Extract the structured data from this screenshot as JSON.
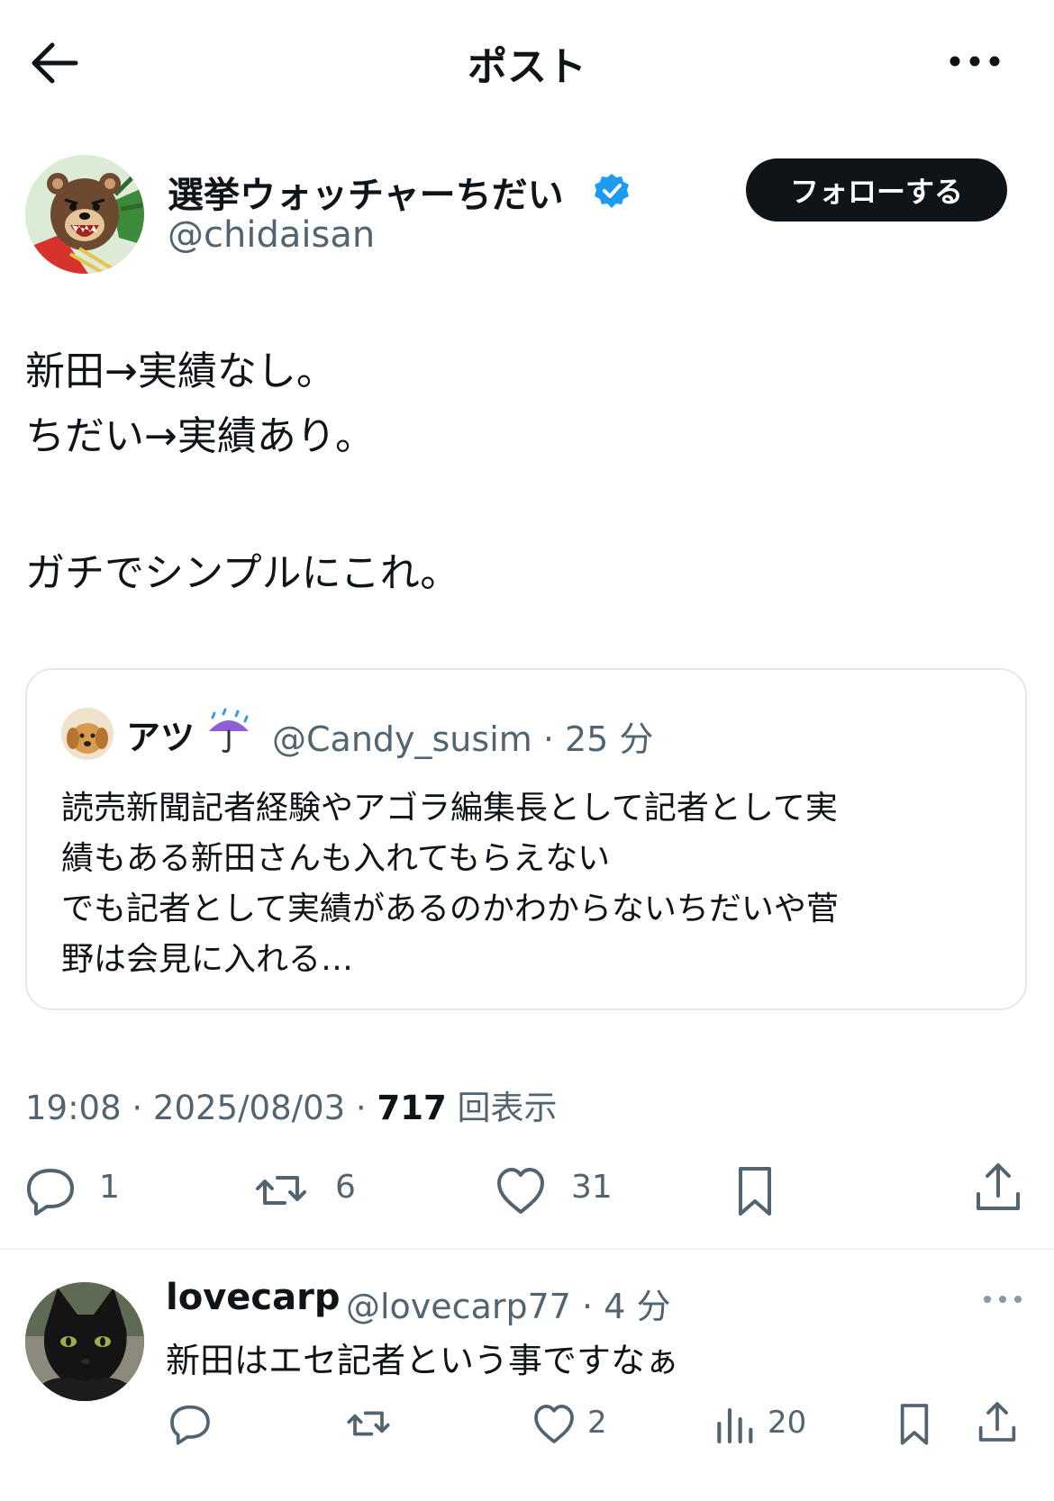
{
  "header": {
    "title": "ポスト"
  },
  "post": {
    "author_name": "選挙ウォッチャーちだい",
    "handle": "@chidaisan",
    "follow_label": "フォローする",
    "lines": [
      "新田→実績なし。",
      "ちだい→実績あり。",
      "",
      "ガチでシンプルにこれ。"
    ],
    "timestamp": "19:08 · 2025/08/03 · ",
    "views": "717",
    "views_label": " 回表示",
    "counts": {
      "replies": "1",
      "reposts": "6",
      "likes": "31"
    }
  },
  "quote": {
    "name": "アツ",
    "handle_time": "@Candy_susim · 25 分",
    "lines": [
      "読売新聞記者経験やアゴラ編集長として記者として実",
      "績もある新田さんも入れてもらえない",
      "でも記者として実績があるのかわからないちだいや菅",
      "野は会見に入れる…"
    ]
  },
  "reply": {
    "name": "lovecarp",
    "handle_time": "@lovecarp77 · 4 分",
    "text": "新田はエセ記者という事ですなぁ",
    "counts": {
      "likes": "2",
      "views": "20"
    }
  },
  "colors": {
    "verified": "#1d9bf0",
    "secondary_text": "#536471",
    "primary_text": "#0f1419"
  },
  "icons": [
    "back-arrow-icon",
    "more-icon",
    "verified-badge-icon",
    "reply-icon",
    "repost-icon",
    "like-icon",
    "bookmark-icon",
    "share-icon",
    "views-icon"
  ]
}
